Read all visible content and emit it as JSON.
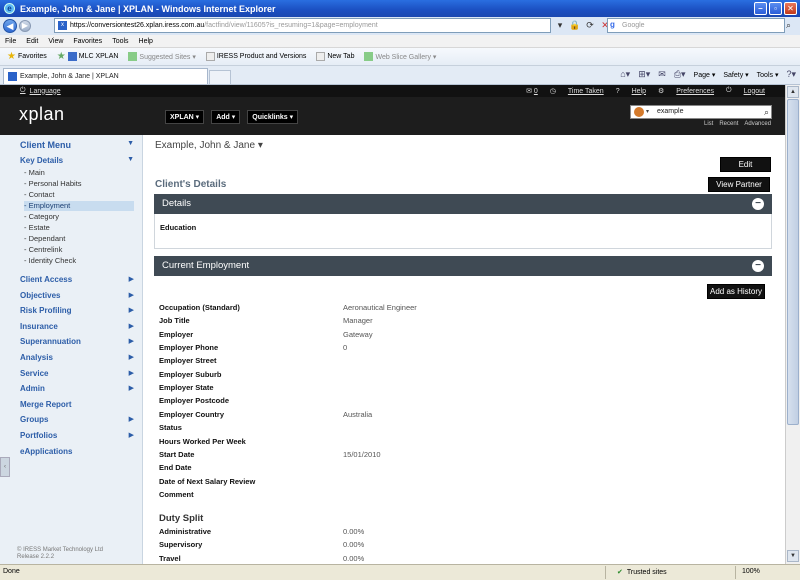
{
  "browser": {
    "window_title": "Example, John & Jane | XPLAN - Windows Internet Explorer",
    "url_host": "https://conversiontest26.xplan.iress.com.au",
    "url_path": "/factfind/view/11605?is_resuming=1&page=employment",
    "search_placeholder": "Google",
    "menu": [
      "File",
      "Edit",
      "View",
      "Favorites",
      "Tools",
      "Help"
    ],
    "favorites_label": "Favorites",
    "favorites": [
      {
        "label": "MLC XPLAN",
        "dim": false
      },
      {
        "label": "Suggested Sites ▾",
        "dim": true
      },
      {
        "label": "IRESS Product and Versions",
        "dim": false
      },
      {
        "label": "New Tab",
        "dim": false
      },
      {
        "label": "Web Slice Gallery ▾",
        "dim": true
      }
    ],
    "tab_title": "Example, John & Jane | XPLAN",
    "commands": [
      "Page ▾",
      "Safety ▾",
      "Tools ▾"
    ],
    "status": "Done",
    "zone": "Trusted sites",
    "zoom": "100%"
  },
  "xplan": {
    "language_label": "Language",
    "messages_count": "0",
    "links": {
      "time_taken": "Time Taken",
      "help": "Help",
      "preferences": "Preferences",
      "logout": "Logout"
    },
    "logo": "xplan",
    "menus": [
      "XPLAN ▾",
      "Add ▾",
      "Quicklinks ▾"
    ],
    "search_value": "example",
    "search_links": [
      "List",
      "Recent",
      "Advanced"
    ]
  },
  "sidebar": {
    "title": "Client Menu",
    "key_details_label": "Key Details",
    "key_details_items": [
      {
        "label": "- Main",
        "active": false
      },
      {
        "label": "- Personal Habits",
        "active": false
      },
      {
        "label": "- Contact",
        "active": false
      },
      {
        "label": "- Employment",
        "active": true
      },
      {
        "label": "- Category",
        "active": false
      },
      {
        "label": "- Estate",
        "active": false
      },
      {
        "label": "- Dependant",
        "active": false
      },
      {
        "label": "- Centrelink",
        "active": false
      },
      {
        "label": "- Identity Check",
        "active": false
      }
    ],
    "sections": [
      {
        "label": "Client Access",
        "arrow": true
      },
      {
        "label": "Objectives",
        "arrow": true
      },
      {
        "label": "Risk Profiling",
        "arrow": true
      },
      {
        "label": "Insurance",
        "arrow": true
      },
      {
        "label": "Superannuation",
        "arrow": true
      },
      {
        "label": "Analysis",
        "arrow": true
      },
      {
        "label": "Service",
        "arrow": true
      },
      {
        "label": "Admin",
        "arrow": true
      },
      {
        "label": "Merge Report",
        "arrow": false
      },
      {
        "label": "Groups",
        "arrow": true
      },
      {
        "label": "Portfolios",
        "arrow": true
      },
      {
        "label": "eApplications",
        "arrow": false
      }
    ],
    "footer_line1": "© IRESS Market Technology Ltd",
    "footer_line2": "Release 2.2.2"
  },
  "main": {
    "client_name": "Example, John & Jane ▾",
    "edit_label": "Edit",
    "view_partner_label": "View Partner",
    "section_title": "Client's Details",
    "details_panel": {
      "title": "Details",
      "field": "Education"
    },
    "employment_panel": {
      "title": "Current Employment",
      "add_history_label": "Add as History",
      "fields": [
        {
          "label": "Occupation (Standard)",
          "value": "Aeronautical Engineer"
        },
        {
          "label": "Job Title",
          "value": "Manager"
        },
        {
          "label": "Employer",
          "value": "Gateway"
        },
        {
          "label": "Employer Phone",
          "value": "0"
        },
        {
          "label": "Employer Street",
          "value": ""
        },
        {
          "label": "Employer Suburb",
          "value": ""
        },
        {
          "label": "Employer State",
          "value": ""
        },
        {
          "label": "Employer Postcode",
          "value": ""
        },
        {
          "label": "Employer Country",
          "value": "Australia"
        },
        {
          "label": "Status",
          "value": ""
        },
        {
          "label": "Hours Worked Per Week",
          "value": ""
        },
        {
          "label": "Start Date",
          "value": "15/01/2010"
        },
        {
          "label": "End Date",
          "value": ""
        },
        {
          "label": "Date of Next Salary Review",
          "value": ""
        },
        {
          "label": "Comment",
          "value": ""
        }
      ],
      "duty_split_title": "Duty Split",
      "duty_split": [
        {
          "label": "Administrative",
          "value": "0.00%"
        },
        {
          "label": "Supervisory",
          "value": "0.00%"
        },
        {
          "label": "Travel",
          "value": "0.00%"
        }
      ]
    }
  }
}
